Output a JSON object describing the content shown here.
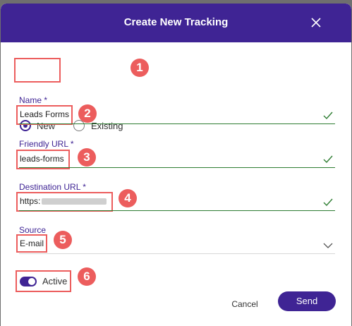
{
  "dialog": {
    "title": "Create New Tracking",
    "close_icon": "close-icon"
  },
  "mode": {
    "options": [
      {
        "label": "New",
        "selected": true
      },
      {
        "label": "Existing",
        "selected": false
      }
    ]
  },
  "fields": {
    "name": {
      "label": "Name *",
      "value": "Leads Forms",
      "valid_icon": "check-icon"
    },
    "friendly_url": {
      "label": "Friendly URL *",
      "value": "leads-forms",
      "valid_icon": "check-icon"
    },
    "destination_url": {
      "label": "Destination URL *",
      "value": "https:",
      "valid_icon": "check-icon"
    },
    "source": {
      "label": "Source",
      "value": "E-mail",
      "dropdown_icon": "chevron-down-icon"
    }
  },
  "active_toggle": {
    "label": "Active",
    "on": true
  },
  "actions": {
    "cancel": "Cancel",
    "send": "Send"
  },
  "annotations": [
    "1",
    "2",
    "3",
    "4",
    "5",
    "6"
  ],
  "colors": {
    "accent": "#3f2494",
    "annotation": "#ec5d5d",
    "valid": "#2e7d32"
  }
}
